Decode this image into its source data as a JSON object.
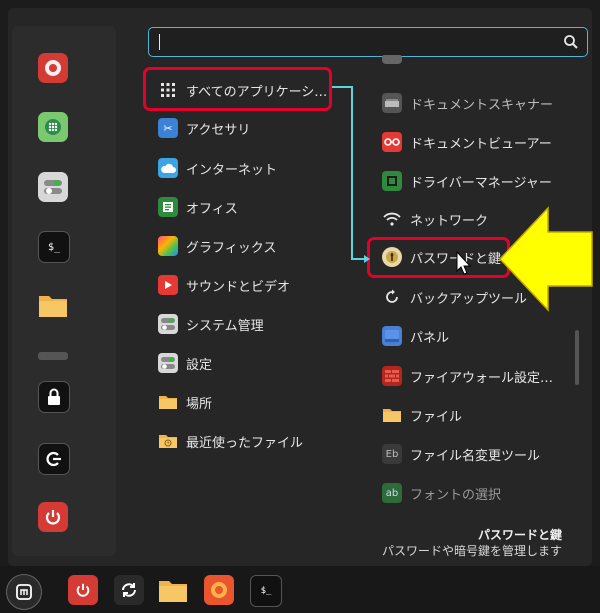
{
  "search": {
    "placeholder": ""
  },
  "categories": [
    {
      "label": "すべてのアプリケーシ…",
      "icon": "grid-icon"
    },
    {
      "label": "アクセサリ",
      "icon": "scissors-icon"
    },
    {
      "label": "インターネット",
      "icon": "cloud-icon"
    },
    {
      "label": "オフィス",
      "icon": "document-icon"
    },
    {
      "label": "グラフィックス",
      "icon": "palette-icon"
    },
    {
      "label": "サウンドとビデオ",
      "icon": "play-icon"
    },
    {
      "label": "システム管理",
      "icon": "toggle-icon"
    },
    {
      "label": "設定",
      "icon": "settings-icon"
    },
    {
      "label": "場所",
      "icon": "folder-icon"
    },
    {
      "label": "最近使ったファイル",
      "icon": "recent-folder-icon"
    }
  ],
  "apps": [
    {
      "label": "ドキュメントスキャナー",
      "icon": "scanner-icon"
    },
    {
      "label": "ドキュメントビューアー",
      "icon": "glasses-icon"
    },
    {
      "label": "ドライバーマネージャー",
      "icon": "driver-icon"
    },
    {
      "label": "ネットワーク",
      "icon": "wifi-icon"
    },
    {
      "label": "パスワードと鍵",
      "icon": "keyring-icon"
    },
    {
      "label": "バックアップツール",
      "icon": "backup-icon"
    },
    {
      "label": "パネル",
      "icon": "panel-icon"
    },
    {
      "label": "ファイアウォール設定…",
      "icon": "firewall-icon"
    },
    {
      "label": "ファイル",
      "icon": "folder-icon"
    },
    {
      "label": "ファイル名変更ツール",
      "icon": "rename-icon"
    },
    {
      "label": "フォントの選択",
      "icon": "font-icon"
    }
  ],
  "description": {
    "title": "パスワードと鍵",
    "text": "パスワードや暗号鍵を管理します"
  },
  "favorites": [
    "firefox-icon",
    "app-grid-icon",
    "toggle-icon",
    "terminal-icon",
    "folder-icon",
    "lock-icon",
    "logout-icon",
    "power-icon"
  ],
  "taskbar": [
    "mint-menu-icon",
    "power-icon",
    "refresh-icon",
    "folder-icon",
    "firefox-icon",
    "terminal-icon"
  ],
  "colors": {
    "accent": "#54b5d6",
    "highlight": "#e4002b",
    "arrow": "#ffff00",
    "connector": "#5fd3e0"
  }
}
